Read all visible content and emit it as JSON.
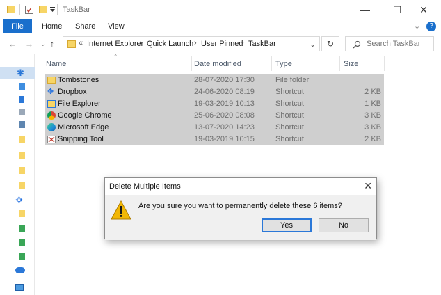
{
  "window": {
    "title": "TaskBar",
    "minimize_glyph": "—",
    "maximize_glyph": "☐",
    "close_glyph": "✕"
  },
  "ribbon": {
    "tabs": [
      {
        "label": "File",
        "active": true
      },
      {
        "label": "Home"
      },
      {
        "label": "Share"
      },
      {
        "label": "View"
      }
    ],
    "help_glyph": "?"
  },
  "address": {
    "prefix": "«",
    "crumbs": [
      "Internet Explorer",
      "Quick Launch",
      "User Pinned",
      "TaskBar"
    ],
    "search_placeholder": "Search TaskBar"
  },
  "columns": {
    "name": "Name",
    "date": "Date modified",
    "type": "Type",
    "size": "Size"
  },
  "files": [
    {
      "name": "Tombstones",
      "date": "28-07-2020 17:30",
      "type": "File folder",
      "size": "",
      "icon": "folder-icon"
    },
    {
      "name": "Dropbox",
      "date": "24-06-2020 08:19",
      "type": "Shortcut",
      "size": "2 KB",
      "icon": "dropbox-shortcut-icon"
    },
    {
      "name": "File Explorer",
      "date": "19-03-2019 10:13",
      "type": "Shortcut",
      "size": "1 KB",
      "icon": "file-explorer-shortcut-icon"
    },
    {
      "name": "Google Chrome",
      "date": "25-06-2020 08:08",
      "type": "Shortcut",
      "size": "3 KB",
      "icon": "chrome-shortcut-icon"
    },
    {
      "name": "Microsoft Edge",
      "date": "13-07-2020 14:23",
      "type": "Shortcut",
      "size": "3 KB",
      "icon": "edge-shortcut-icon"
    },
    {
      "name": "Snipping Tool",
      "date": "19-03-2019 10:15",
      "type": "Shortcut",
      "size": "2 KB",
      "icon": "snipping-tool-shortcut-icon"
    }
  ],
  "dialog": {
    "title": "Delete Multiple Items",
    "message": "Are you sure you want to permanently delete these 6 items?",
    "yes": "Yes",
    "no": "No"
  },
  "colors": {
    "accent": "#1a6fcc",
    "selection": "#cfcfcf",
    "warning": "#f2b705"
  }
}
